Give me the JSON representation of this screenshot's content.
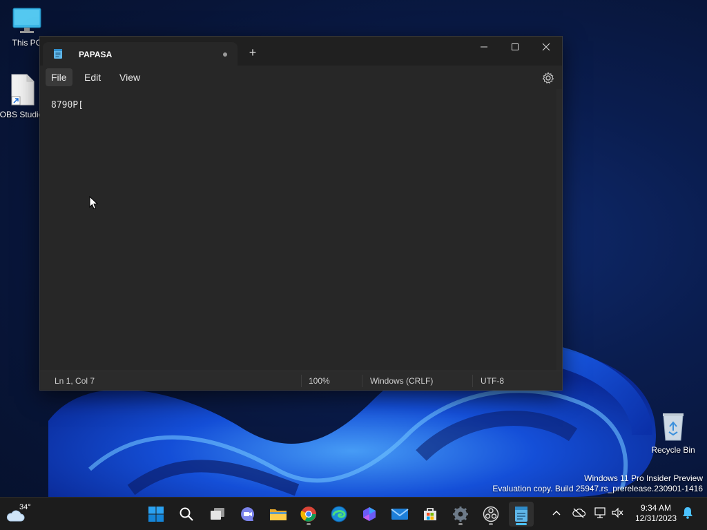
{
  "desktop": {
    "icons": [
      {
        "label": "This PC"
      },
      {
        "label": "OBS Studio"
      },
      {
        "label": "Recycle Bin"
      }
    ],
    "watermark": {
      "line1": "Windows 11 Pro Insider Preview",
      "line2": "Evaluation copy. Build 25947.rs_prerelease.230901-1416"
    }
  },
  "notepad": {
    "tab": {
      "title": "PAPASA",
      "unsaved": true
    },
    "new_tab_symbol": "+",
    "menu": [
      {
        "label": "File"
      },
      {
        "label": "Edit"
      },
      {
        "label": "View"
      }
    ],
    "content": "8790P[",
    "status": {
      "position": "Ln 1, Col 7",
      "zoom": "100%",
      "line_ending": "Windows (CRLF)",
      "encoding": "UTF-8"
    }
  },
  "taskbar": {
    "weather": {
      "temp": "34°"
    },
    "apps": [
      {
        "name": "start",
        "icon": "windows-logo-icon"
      },
      {
        "name": "search",
        "icon": "search-icon"
      },
      {
        "name": "task-view",
        "icon": "task-view-icon"
      },
      {
        "name": "chat",
        "icon": "chat-camera-icon"
      },
      {
        "name": "file-explorer",
        "icon": "folder-icon"
      },
      {
        "name": "chrome",
        "icon": "chrome-icon"
      },
      {
        "name": "edge",
        "icon": "edge-icon"
      },
      {
        "name": "copilot",
        "icon": "copilot-icon"
      },
      {
        "name": "mail",
        "icon": "mail-icon"
      },
      {
        "name": "store",
        "icon": "store-icon"
      },
      {
        "name": "settings",
        "icon": "gear-icon"
      },
      {
        "name": "obs",
        "icon": "obs-icon"
      },
      {
        "name": "notepad",
        "icon": "notepad-icon"
      }
    ],
    "clock": {
      "time": "9:34 AM",
      "date": "12/31/2023"
    }
  },
  "colors": {
    "accent": "#4cc2ff",
    "window_bg": "#272727",
    "titlebar_bg": "#202020",
    "taskbar_bg": "#1c1c1c"
  }
}
